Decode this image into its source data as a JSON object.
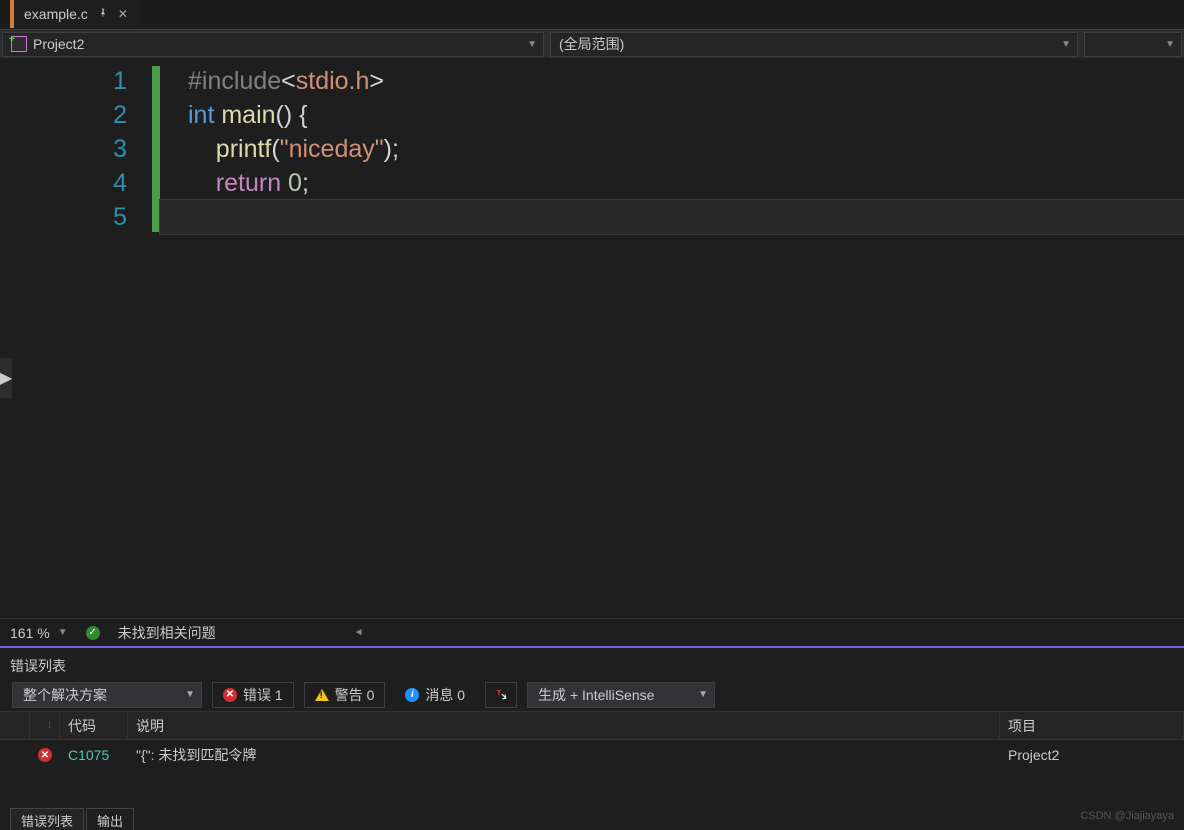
{
  "tab": {
    "filename": "example.c"
  },
  "context": {
    "project": "Project2",
    "scope": "(全局范围)"
  },
  "code": {
    "lines": [
      "1",
      "2",
      "3",
      "4",
      "5"
    ],
    "l1_pp": "#",
    "l1_inc": "include",
    "l1_a": "<",
    "l1_h": "stdio.h",
    "l1_b": ">",
    "l2_t": "int",
    "l2_f": " main",
    "l2_r": "() {",
    "l3_f": "printf",
    "l3_a": "(",
    "l3_s": "\"niceday\"",
    "l3_b": ");",
    "l4_k": "return",
    "l4_n": " 0",
    "l4_r": ";"
  },
  "editor_status": {
    "zoom": "161 %",
    "issues": "未找到相关问题"
  },
  "error_panel": {
    "title": "错误列表",
    "solution_scope": "整个解决方案",
    "errors_label": "错误 1",
    "warnings_label": "警告 0",
    "messages_label": "消息 0",
    "source_filter": "生成 + IntelliSense",
    "columns": {
      "code": "代码",
      "desc": "说明",
      "project": "项目"
    },
    "rows": [
      {
        "code": "C1075",
        "desc": "\"{\": 未找到匹配令牌",
        "project": "Project2"
      }
    ]
  },
  "bottom_tabs": {
    "t1": "错误列表",
    "t2": "输出"
  },
  "watermark": "CSDN @Jiajiayaya"
}
